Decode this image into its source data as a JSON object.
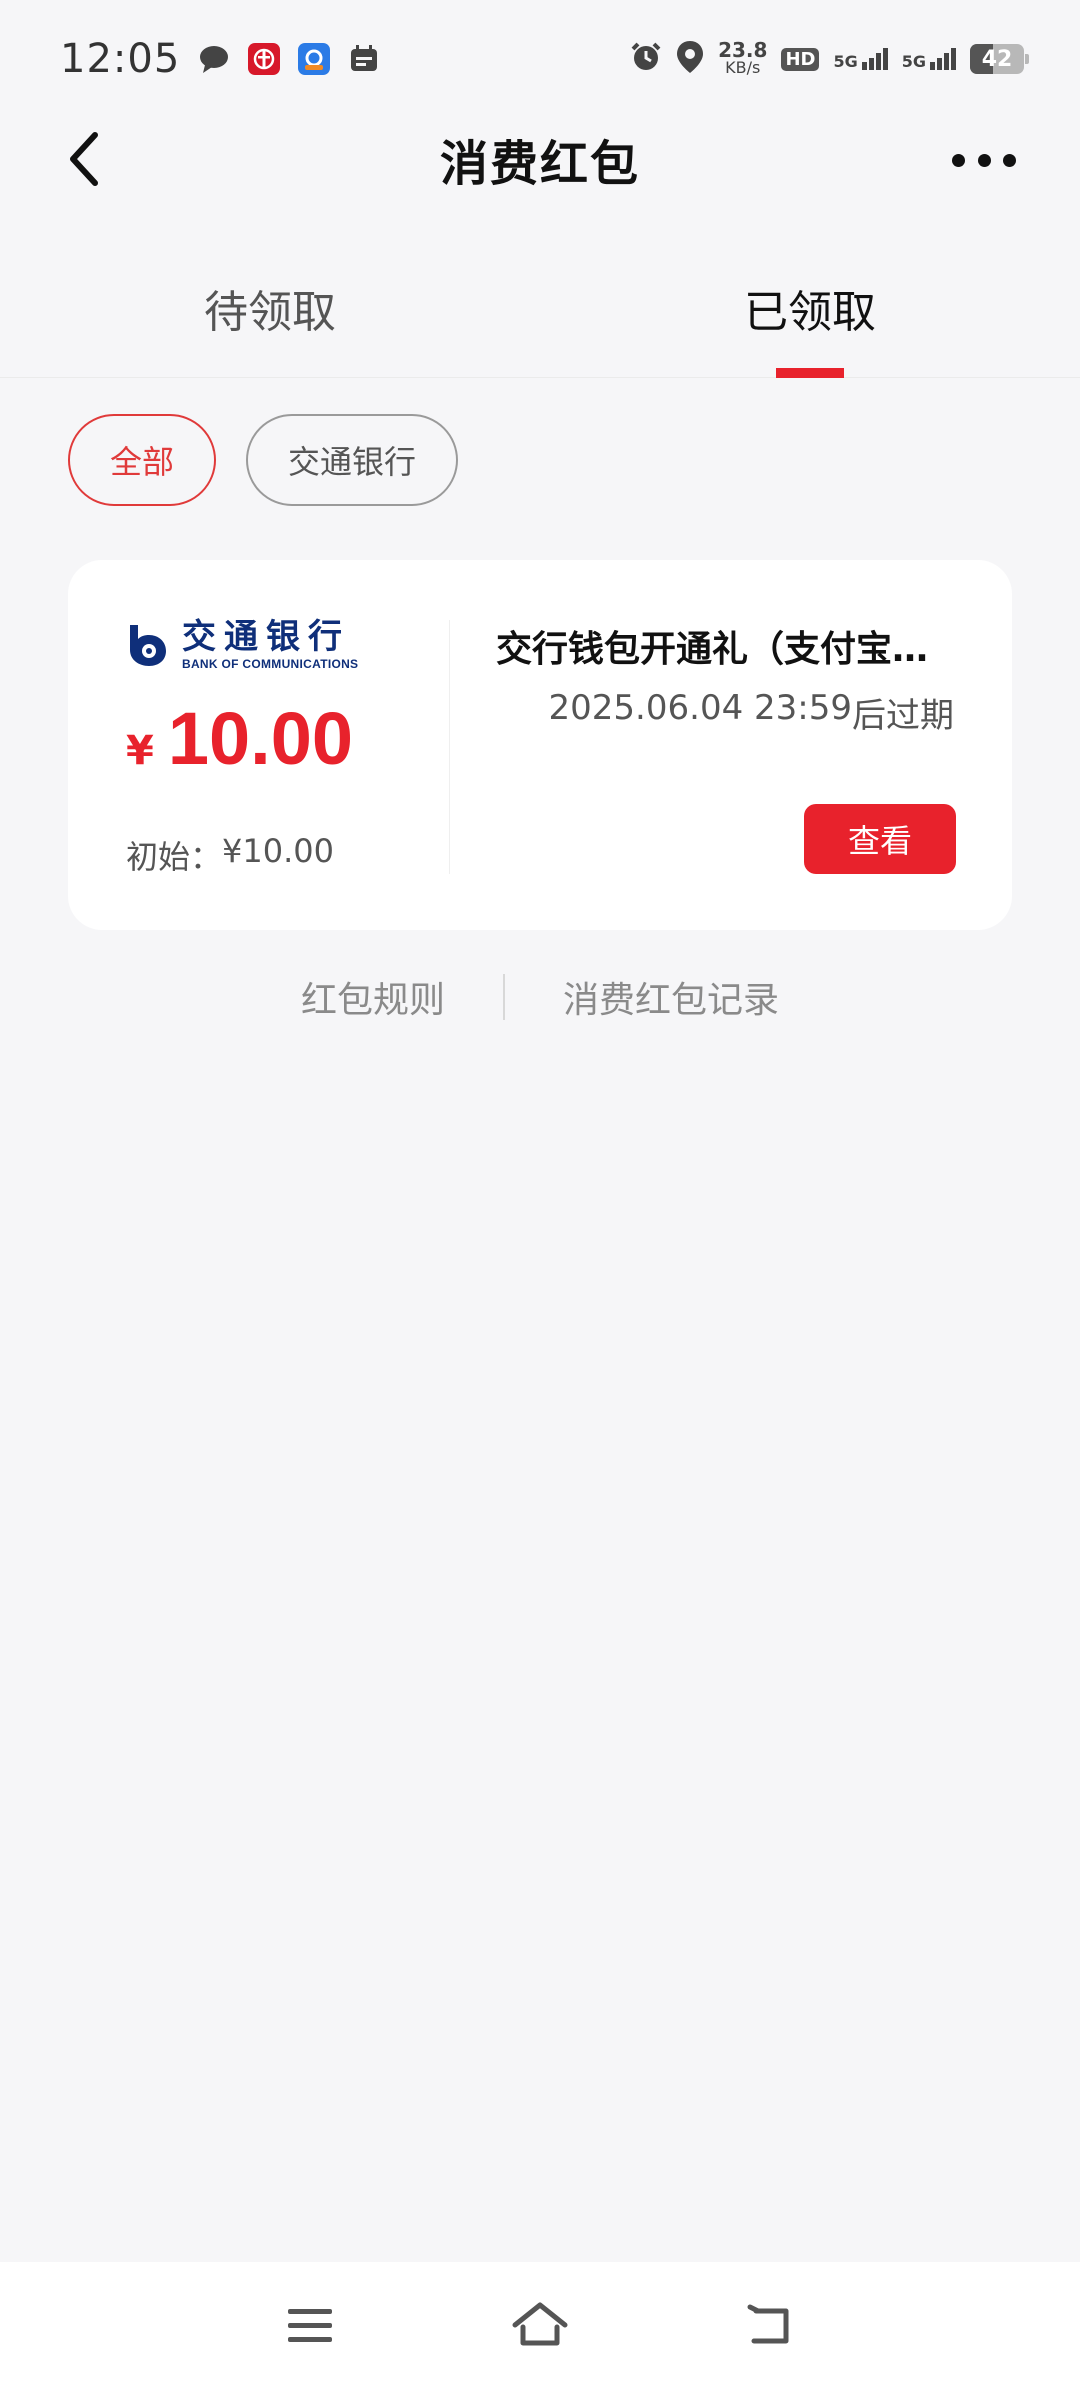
{
  "status_bar": {
    "time": "12:05",
    "net_speed_value": "23.8",
    "net_speed_unit": "KB/s",
    "hd_label": "HD",
    "sim1_label": "5G",
    "sim2_label": "5G",
    "battery_level": "42",
    "battery_fraction": 0.42,
    "icons": [
      "message-icon",
      "bank-app-icon",
      "wallet-app-icon",
      "calendar-icon",
      "alarm-icon",
      "location-icon"
    ]
  },
  "nav": {
    "title": "消费红包",
    "back_icon": "chevron-left-icon",
    "more_icon": "more-dots-icon"
  },
  "tabs": [
    {
      "label": "待领取",
      "active": false
    },
    {
      "label": "已领取",
      "active": true
    }
  ],
  "filters": [
    {
      "label": "全部",
      "active": true
    },
    {
      "label": "交通银行",
      "active": false
    }
  ],
  "coupon": {
    "bank_name_cn": "交通银行",
    "bank_name_en": "BANK OF COMMUNICATIONS",
    "currency_symbol": "¥",
    "amount": "10.00",
    "initial_label": "初始：",
    "initial_amount": "¥10.00",
    "name": "交行钱包开通礼（支付宝消费红包）",
    "expiry_datetime": "2025.06.04 23:59",
    "expiry_suffix": "后过期",
    "view_label": "查看"
  },
  "footer": {
    "rules_label": "红包规则",
    "records_label": "消费红包记录"
  },
  "system_nav": {
    "menu_icon": "menu-icon",
    "home_icon": "home-icon",
    "back_icon": "back-icon"
  },
  "colors": {
    "accent_red": "#e8222c",
    "bank_blue": "#0f2f7a",
    "background": "#f6f6f8"
  }
}
